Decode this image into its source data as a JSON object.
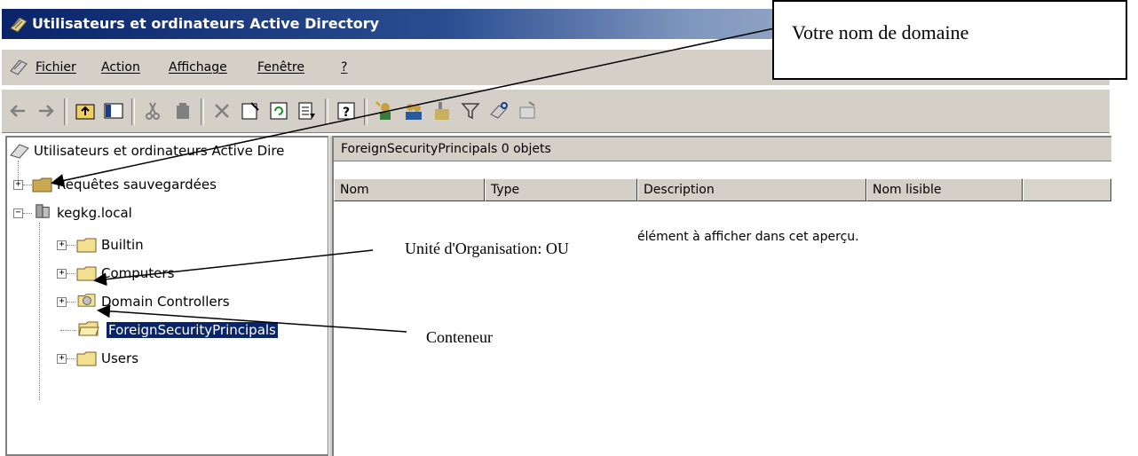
{
  "window": {
    "title": "Utilisateurs et ordinateurs Active Directory"
  },
  "menu": {
    "items": [
      "Fichier",
      "Action",
      "Affichage",
      "Fenêtre",
      "?"
    ]
  },
  "toolbar": {
    "buttons": [
      "back-icon",
      "forward-icon",
      "up-icon",
      "show-hide-tree-icon",
      "cut-icon",
      "delete-icon",
      "properties-icon",
      "refresh-icon",
      "export-list-icon",
      "help-icon",
      "new-user-icon",
      "new-group-icon",
      "new-ou-icon",
      "filter-icon",
      "find-icon",
      "add-to-group-icon"
    ]
  },
  "tree": {
    "root": "Utilisateurs et ordinateurs Active Dire",
    "saved_queries": "Requêtes sauvegardées",
    "domain": "kegkg.local",
    "children": [
      "Builtin",
      "Computers",
      "Domain Controllers",
      "ForeignSecurityPrincipals",
      "Users"
    ],
    "selected": "ForeignSecurityPrincipals"
  },
  "details": {
    "header": "ForeignSecurityPrincipals   0 objets",
    "columns": [
      "Nom",
      "Type",
      "Description",
      "Nom lisible"
    ],
    "empty_message": "élément à afficher dans cet aperçu."
  },
  "annotations": {
    "domain_callout": "Votre nom de domaine",
    "ou_label": "Unité d'Organisation: OU",
    "container_label": "Conteneur"
  },
  "colors": {
    "title_start": "#0a246a",
    "selection": "#0a246a",
    "chrome": "#d4d0c8"
  }
}
